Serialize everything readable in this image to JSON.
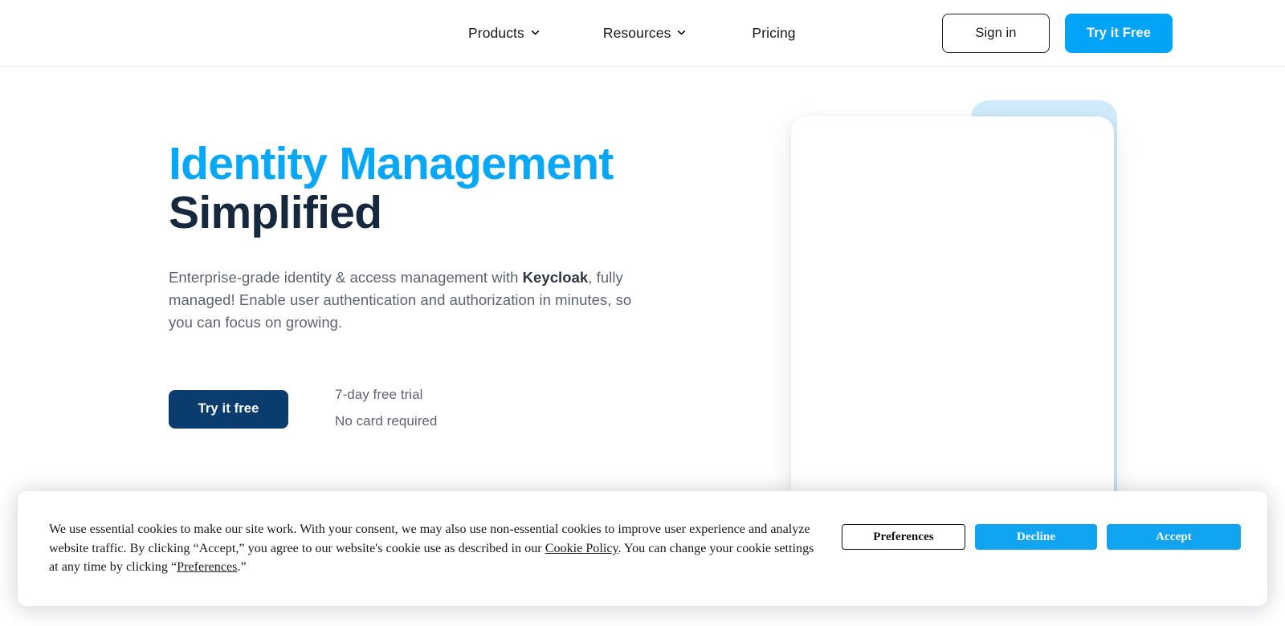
{
  "header": {
    "nav": [
      {
        "label": "Products",
        "has_caret": true,
        "icon": "chevron-down-icon"
      },
      {
        "label": "Resources",
        "has_caret": true,
        "icon": "chevron-down-icon"
      },
      {
        "label": "Pricing",
        "has_caret": false,
        "icon": ""
      }
    ],
    "sign_in_label": "Sign in",
    "try_free_label": "Try it Free"
  },
  "hero": {
    "title_line1": "Identity Management",
    "title_line2": "Simplified",
    "subtitle_part1": "Enterprise-grade identity & access management with ",
    "subtitle_brand": "Keycloak",
    "subtitle_part2": ", fully managed! Enable user authentication and authorization in minutes, so you can focus on growing.",
    "cta_label": "Try it free",
    "trial_line1": "7-day free trial",
    "trial_line2": "No card required"
  },
  "cookie": {
    "text_part1": "We use essential cookies to make our site work. With your consent, we may also use non-essential cookies to improve user experience and analyze website traffic. By clicking “Accept,” you agree to our website's cookie use as described in our ",
    "link_policy": "Cookie Policy",
    "text_part2": ". You can change your cookie settings at any time by clicking “",
    "link_prefs": "Preferences",
    "text_part3": ".”",
    "preferences_label": "Preferences",
    "decline_label": "Decline",
    "accept_label": "Accept"
  },
  "colors": {
    "brand_blue": "#03A3F7",
    "accent_cyan": "#09A7F7",
    "navy": "#16283E",
    "cta_navy": "#0A3C6E",
    "cookie_blue": "#11A4F1",
    "deco_blue": "#CFEBFC",
    "body_text": "#5C6470"
  }
}
